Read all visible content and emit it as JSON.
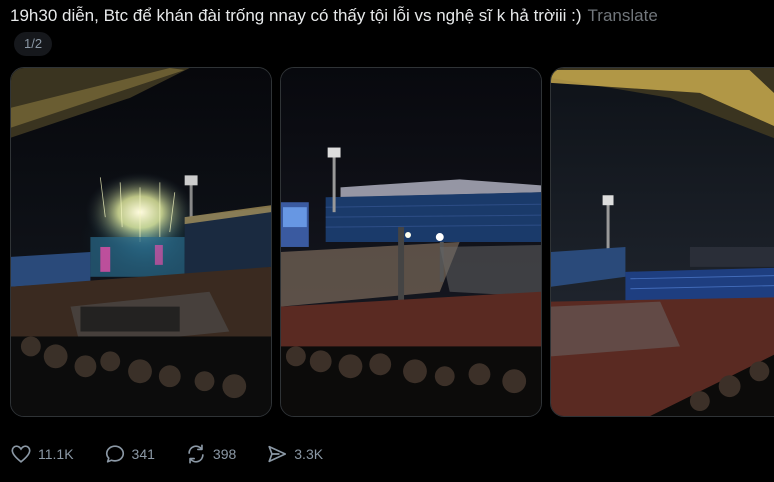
{
  "post": {
    "text": "19h30 diễn, Btc để khán đài trống nnay có thấy tội lỗi vs nghệ sĩ k hả trờiii :)",
    "translate_label": "Translate",
    "media_counter": "1/2"
  },
  "media": [
    {
      "description_icon": "stadium-fireworks-photo"
    },
    {
      "description_icon": "stadium-stage-photo"
    },
    {
      "description_icon": "stadium-stands-photo"
    }
  ],
  "actions": {
    "like_count": "11.1K",
    "reply_count": "341",
    "repost_count": "398",
    "share_count": "3.3K"
  },
  "colors": {
    "background": "#000000",
    "text": "#e7e9ea",
    "muted": "#71767b",
    "icon": "#8b98a5"
  }
}
